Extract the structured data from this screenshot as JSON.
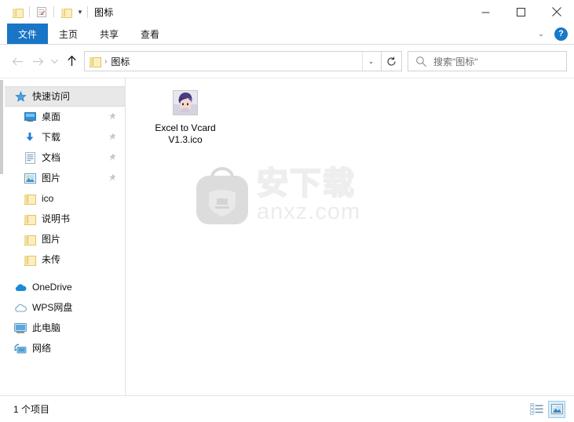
{
  "window": {
    "title": "图标",
    "quick_access": [
      {
        "name": "folder-icon",
        "label": "文件夹"
      },
      {
        "name": "properties-icon",
        "label": "属性"
      },
      {
        "name": "new-folder-icon",
        "label": "新建文件夹"
      }
    ],
    "controls": {
      "minimize": "最小化",
      "maximize": "最大化",
      "close": "关闭"
    }
  },
  "ribbon": {
    "tabs": [
      {
        "label": "文件",
        "selected": true
      },
      {
        "label": "主页",
        "selected": false
      },
      {
        "label": "共享",
        "selected": false
      },
      {
        "label": "查看",
        "selected": false
      }
    ],
    "expand_label": "展开功能区",
    "help_label": "?"
  },
  "nav": {
    "back": "后退",
    "forward": "前进",
    "recent": "最近浏览的位置",
    "up": "上移到“图标”",
    "refresh": "刷新"
  },
  "address": {
    "folder_icon": "folder-icon",
    "separator": "›",
    "crumb": "图标",
    "dropdown": "∨"
  },
  "search": {
    "placeholder": "搜索\"图标\"",
    "value": ""
  },
  "sidebar": {
    "items": [
      {
        "label": "快速访问",
        "icon": "quick-access-star-icon",
        "selected": true,
        "pinned": false,
        "indent": false
      },
      {
        "label": "桌面",
        "icon": "desktop-icon",
        "selected": false,
        "pinned": true,
        "indent": true
      },
      {
        "label": "下载",
        "icon": "downloads-arrow-icon",
        "selected": false,
        "pinned": true,
        "indent": true
      },
      {
        "label": "文档",
        "icon": "documents-icon",
        "selected": false,
        "pinned": true,
        "indent": true
      },
      {
        "label": "图片",
        "icon": "pictures-icon",
        "selected": false,
        "pinned": true,
        "indent": true
      },
      {
        "label": "ico",
        "icon": "folder-icon",
        "selected": false,
        "pinned": false,
        "indent": true
      },
      {
        "label": "说明书",
        "icon": "folder-icon",
        "selected": false,
        "pinned": false,
        "indent": true
      },
      {
        "label": "图片",
        "icon": "folder-icon",
        "selected": false,
        "pinned": false,
        "indent": true
      },
      {
        "label": "未传",
        "icon": "folder-icon",
        "selected": false,
        "pinned": false,
        "indent": true
      }
    ],
    "roots": [
      {
        "label": "OneDrive",
        "icon": "onedrive-cloud-icon"
      },
      {
        "label": "WPS网盘",
        "icon": "wps-cloud-icon"
      },
      {
        "label": "此电脑",
        "icon": "this-pc-monitor-icon"
      },
      {
        "label": "网络",
        "icon": "network-icon"
      }
    ]
  },
  "content": {
    "files": [
      {
        "name": "Excel to Vcard\nV1.3.ico",
        "icon": "ico-thumbnail"
      }
    ],
    "watermark": {
      "chinese": "安下载",
      "english": "anxz.com"
    }
  },
  "status": {
    "item_count": "1 个项目",
    "views": [
      {
        "name": "details-view",
        "label": "详细信息",
        "active": false
      },
      {
        "name": "large-icons-view",
        "label": "大图标",
        "active": true
      }
    ]
  },
  "colors": {
    "accent": "#1975c5",
    "folder": "#fbeec2",
    "selection": "#dcedf9",
    "help": "#1779c8"
  }
}
